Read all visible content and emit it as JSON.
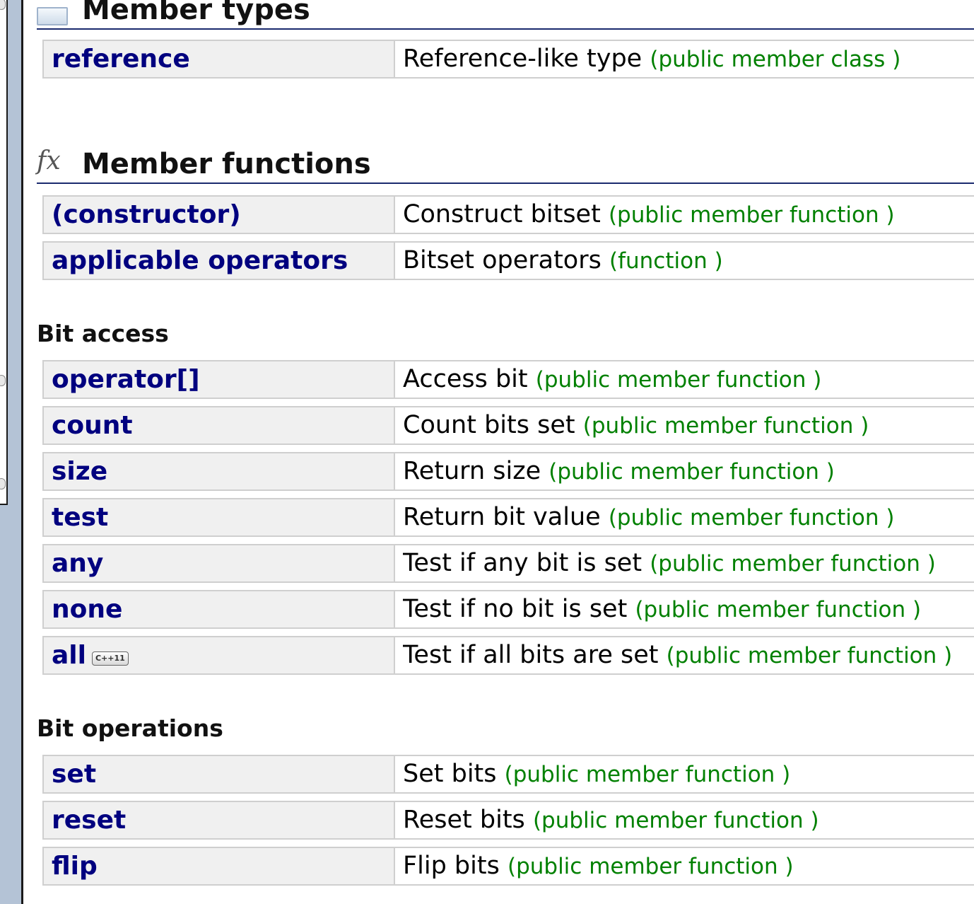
{
  "sections": {
    "member_types": {
      "title": "Member types",
      "icon": "member-types-icon",
      "rows": [
        {
          "name": "reference",
          "desc": "Reference-like type",
          "kind": "(public member class )"
        }
      ]
    },
    "member_functions": {
      "title": "Member functions",
      "icon": "fx-icon",
      "icon_glyph": "fx",
      "rows": [
        {
          "name": "(constructor)",
          "desc": "Construct bitset",
          "kind": "(public member function )"
        },
        {
          "name": "applicable operators",
          "desc": "Bitset operators",
          "kind": "(function )"
        }
      ]
    },
    "bit_access": {
      "title": "Bit access",
      "rows": [
        {
          "name": "operator[]",
          "desc": "Access bit",
          "kind": "(public member function )"
        },
        {
          "name": "count",
          "desc": "Count bits set",
          "kind": "(public member function )"
        },
        {
          "name": "size",
          "desc": "Return size",
          "kind": "(public member function )"
        },
        {
          "name": "test",
          "desc": "Return bit value",
          "kind": "(public member function )"
        },
        {
          "name": "any",
          "desc": "Test if any bit is set",
          "kind": "(public member function )"
        },
        {
          "name": "none",
          "desc": "Test if no bit is set",
          "kind": "(public member function )"
        },
        {
          "name": "all",
          "badge": "C++11",
          "desc": "Test if all bits are set",
          "kind": "(public member function )"
        }
      ]
    },
    "bit_operations": {
      "title": "Bit operations",
      "rows": [
        {
          "name": "set",
          "desc": "Set bits",
          "kind": "(public member function )"
        },
        {
          "name": "reset",
          "desc": "Reset bits",
          "kind": "(public member function )"
        },
        {
          "name": "flip",
          "desc": "Flip bits",
          "kind": "(public member function )"
        }
      ]
    }
  },
  "colors": {
    "link": "#00007f",
    "kind": "#008000",
    "rule": "#1a2a6e",
    "sidebar": "#b4c3d6"
  }
}
